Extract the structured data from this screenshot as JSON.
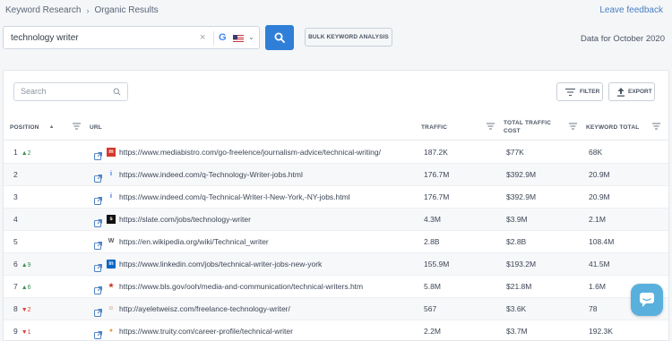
{
  "breadcrumb": [
    "Keyword Research",
    "Organic Results"
  ],
  "breadcrumb_separator": "›",
  "feedback_link": "Leave feedback",
  "search": {
    "value": "technology writer",
    "clear_glyph": "×",
    "engine_icon": "google-icon",
    "engine_glyph": "G",
    "country_flag": "us-flag-icon",
    "caret_glyph": "⌄"
  },
  "bulk_button": "BULK KEYWORD ANALYSIS",
  "data_for": "Data for October 2020",
  "table_search": {
    "placeholder": "Search"
  },
  "filter_button": "FILTER",
  "export_button": "EXPORT",
  "columns": {
    "position": "POSITION",
    "url": "URL",
    "traffic": "TRAFFIC",
    "traffic_cost": "TOTAL TRAFFIC COST",
    "keyword_total": "KEYWORD TOTAL"
  },
  "sort_glyph": "▲",
  "rows": [
    {
      "position": "1",
      "change": "▲2",
      "dir": "up",
      "favicon": "mediabistro-icon",
      "fav_glyph": "m",
      "fav_color": "#d33a2c",
      "url": "https://www.mediabistro.com/go-freelence/journalism-advice/technical-writing/",
      "traffic": "187.2K",
      "cost": "$77K",
      "keywords": "68K"
    },
    {
      "position": "2",
      "change": "",
      "dir": "",
      "favicon": "indeed-icon",
      "fav_glyph": "i",
      "fav_color": "#2164f3",
      "url": "https://www.indeed.com/q-Technology-Writer-jobs.html",
      "traffic": "176.7M",
      "cost": "$392.9M",
      "keywords": "20.9M"
    },
    {
      "position": "3",
      "change": "",
      "dir": "",
      "favicon": "indeed-icon",
      "fav_glyph": "i",
      "fav_color": "#2164f3",
      "url": "https://www.indeed.com/q-Technical-Writer-l-New-York,-NY-jobs.html",
      "traffic": "176.7M",
      "cost": "$392.9M",
      "keywords": "20.9M"
    },
    {
      "position": "4",
      "change": "",
      "dir": "",
      "favicon": "slate-icon",
      "fav_glyph": "s",
      "fav_color": "#111111",
      "url": "https://slate.com/jobs/technology-writer",
      "traffic": "4.3M",
      "cost": "$3.9M",
      "keywords": "2.1M"
    },
    {
      "position": "5",
      "change": "",
      "dir": "",
      "favicon": "wikipedia-icon",
      "fav_glyph": "W",
      "fav_color": "#555555",
      "url": "https://en.wikipedia.org/wiki/Technical_writer",
      "traffic": "2.8B",
      "cost": "$2.8B",
      "keywords": "108.4M"
    },
    {
      "position": "6",
      "change": "▲9",
      "dir": "up",
      "favicon": "linkedin-icon",
      "fav_glyph": "in",
      "fav_color": "#0a66c2",
      "url": "https://www.linkedin.com/jobs/technical-writer-jobs-new-york",
      "traffic": "155.9M",
      "cost": "$193.2M",
      "keywords": "41.5M"
    },
    {
      "position": "7",
      "change": "▲6",
      "dir": "up",
      "favicon": "bls-star-icon",
      "fav_glyph": "★",
      "fav_color": "#c0392b",
      "url": "https://www.bls.gov/ooh/media-and-communication/technical-writers.htm",
      "traffic": "5.8M",
      "cost": "$21.8M",
      "keywords": "1.6M"
    },
    {
      "position": "8",
      "change": "▼2",
      "dir": "down",
      "favicon": "person-avatar-icon",
      "fav_glyph": "☺",
      "fav_color": "#b36b4a",
      "url": "http://ayeletweisz.com/freelance-technology-writer/",
      "traffic": "567",
      "cost": "$3.6K",
      "keywords": "78"
    },
    {
      "position": "9",
      "change": "▼1",
      "dir": "down",
      "favicon": "truity-icon",
      "fav_glyph": "●",
      "fav_color": "#e0a53a",
      "url": "https://www.truity.com/career-profile/technical-writer",
      "traffic": "2.2M",
      "cost": "$3.7M",
      "keywords": "192.3K"
    }
  ]
}
